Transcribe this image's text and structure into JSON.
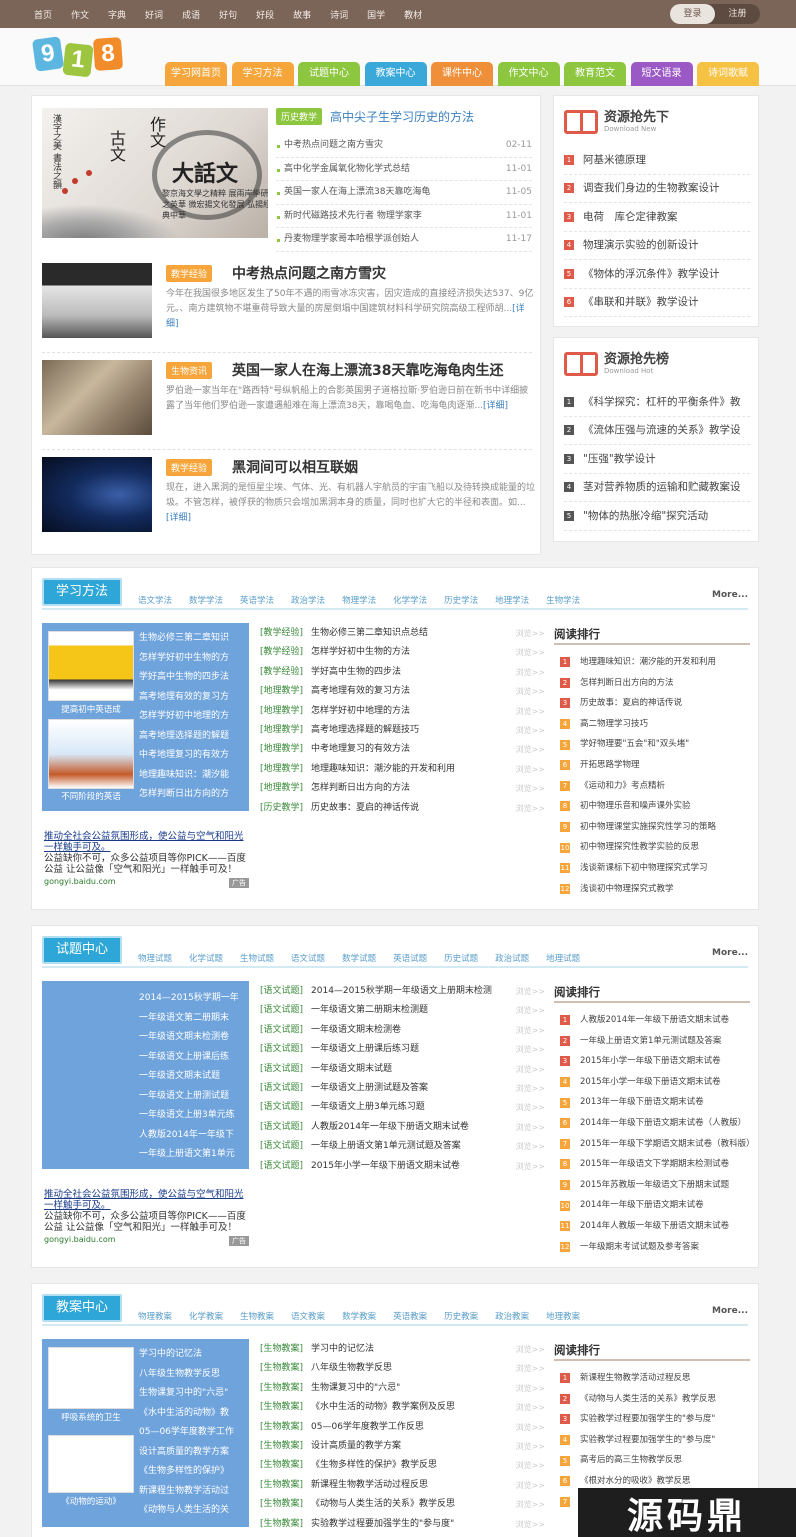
{
  "topnav": [
    "首页",
    "作文",
    "字典",
    "好词",
    "成语",
    "好句",
    "好段",
    "故事",
    "诗词",
    "国学",
    "教材"
  ],
  "auth": {
    "login": "登录",
    "register": "注册"
  },
  "logo": [
    "9",
    "1",
    "8"
  ],
  "mainnav": [
    {
      "label": "学习网首页",
      "color": "#f6a53a"
    },
    {
      "label": "学习方法",
      "color": "#f6a53a"
    },
    {
      "label": "试题中心",
      "color": "#8dc63f"
    },
    {
      "label": "教案中心",
      "color": "#3aa8d8"
    },
    {
      "label": "课件中心",
      "color": "#f08f3a"
    },
    {
      "label": "作文中心",
      "color": "#8dc63f"
    },
    {
      "label": "教育范文",
      "color": "#8dc63f"
    },
    {
      "label": "短文语录",
      "color": "#9b59c6"
    },
    {
      "label": "诗词歌赋",
      "color": "#f6c244"
    }
  ],
  "headline": {
    "image_title": "大話文",
    "image_sub": "黎京海文學之精粹 展兩岸學研之英華 微宏揚文化發展 弘揚經典中華",
    "tag": "历史教学",
    "title": "高中尖子生学习历史的方法",
    "items": [
      {
        "title": "中考热点问题之南方雪灾",
        "date": "02-11"
      },
      {
        "title": "高中化学金属氧化物化学式总结",
        "date": "11-01"
      },
      {
        "title": "英国一家人在海上漂流38天靠吃海龟",
        "date": "11-05"
      },
      {
        "title": "新时代磁路技术先行者 物理学家李",
        "date": "11-01"
      },
      {
        "title": "丹麦物理学家哥本哈根学派创始人",
        "date": "11-17"
      }
    ]
  },
  "articles": [
    {
      "tag": "教学经验",
      "title": "中考热点问题之南方雪灾",
      "desc": "今年在我国很多地区发生了50年不遇的雨雪冰冻灾害，因灾造成的直接经济损失达537、9亿元。、南方建筑物不堪重荷导致大量的房屋倒塌中国建筑材料科学研究院高级工程师胡...",
      "more": "[详细]"
    },
    {
      "tag": "生物资讯",
      "title": "英国一家人在海上漂流38天靠吃海龟肉生还",
      "desc": "罗伯逊一家当年在\"路西特\"号纵帆船上的合影英国男子道格拉斯·罗伯逊日前在新书中详细披露了当年他们罗伯逊一家遭遇船难在海上漂流38天，靠喝龟血、吃海龟肉逐渐...",
      "more": "[详细]"
    },
    {
      "tag": "教学经验",
      "title": "黑洞间可以相互联姻",
      "desc": "现在，进入黑洞的是恒星尘埃、气体、光、有机器人宇航员的宇宙飞船以及待转换成能量的垃圾。不管怎样，被俘获的物质只会增加黑洞本身的质量，同时也扩大它的半径和表面。如...",
      "more": "[详细]"
    }
  ],
  "res_new": {
    "title": "资源抢先下",
    "sub": "Download New",
    "items": [
      "阿基米德原理",
      "调查我们身边的生物教案设计",
      "电荷　库仑定律教案",
      "物理演示实验的创新设计",
      "《物体的浮沉条件》教学设计",
      "《串联和并联》教学设计"
    ]
  },
  "res_hot": {
    "title": "资源抢先榜",
    "sub": "Download Hot",
    "items": [
      "《科学探究：杠杆的平衡条件》教",
      "《流体压强与流速的关系》教学设",
      "\"压强\"教学设计",
      "茎对营养物质的运输和贮藏教案设",
      "\"物体的热胀冷缩\"探究活动"
    ]
  },
  "sections": [
    {
      "tab": "学习方法",
      "subs": [
        "语文学法",
        "数学学法",
        "英语学法",
        "政治学法",
        "物理学法",
        "化学学法",
        "历史学法",
        "地理学法",
        "生物学法"
      ],
      "more": "More...",
      "captions": [
        "提高初中英语成",
        "不同阶段的英语"
      ],
      "links": [
        "生物必修三第二章知识",
        "怎样学好初中生物的方",
        "学好高中生物的四步法",
        "高考地理有效的复习方",
        "怎样学好初中地理的方",
        "高考地理选择题的解题",
        "中考地理复习的有效方",
        "地理趣味知识：潮汐能",
        "怎样判断日出方向的方"
      ],
      "ad": {
        "l1": "推动全社会公益氛围形成，使公益与空气和阳光一样触手可及。",
        "l2": "公益缺你不可，众多公益项目等你PICK——百度公益 让公益像「空气和阳光」一样触手可及！",
        "l3": "gongyi.baidu.com",
        "badge": "广告"
      },
      "mid": [
        {
          "cat": "[教学经验]",
          "title": "生物必修三第二章知识点总结"
        },
        {
          "cat": "[教学经验]",
          "title": "怎样学好初中生物的方法"
        },
        {
          "cat": "[教学经验]",
          "title": "学好高中生物的四步法"
        },
        {
          "cat": "[地理教学]",
          "title": "高考地理有效的复习方法"
        },
        {
          "cat": "[地理教学]",
          "title": "怎样学好初中地理的方法"
        },
        {
          "cat": "[地理教学]",
          "title": "高考地理选择题的解题技巧"
        },
        {
          "cat": "[地理教学]",
          "title": "中考地理复习的有效方法"
        },
        {
          "cat": "[地理教学]",
          "title": "地理趣味知识：潮汐能的开发和利用"
        },
        {
          "cat": "[地理教学]",
          "title": "怎样判断日出方向的方法"
        },
        {
          "cat": "[历史教学]",
          "title": "历史故事：夏启的神话传说"
        }
      ],
      "views": "浏览>>",
      "rank_title": "阅读排行",
      "rank": [
        "地理趣味知识：潮汐能的开发和利用",
        "怎样判断日出方向的方法",
        "历史故事：夏启的神话传说",
        "高二物理学习技巧",
        "学好物理要\"五会\"和\"双头堵\"",
        "开拓思路学物理",
        "《运动和力》考点精析",
        "初中物理乐音和噪声课外实验",
        "初中物理课堂实施探究性学习的策略",
        "初中物理探究性教学实验的反思",
        "浅谈新课标下初中物理探究式学习",
        "浅谈初中物理探究式教学"
      ]
    },
    {
      "tab": "试题中心",
      "subs": [
        "物理试题",
        "化学试题",
        "生物试题",
        "语文试题",
        "数学试题",
        "英语试题",
        "历史试题",
        "政治试题",
        "地理试题"
      ],
      "more": "More...",
      "captions": [],
      "links": [
        "2014—2015秋学期一年",
        "一年级语文第二册期末",
        "一年级语文期末检测卷",
        "一年级语文上册课后练",
        "一年级语文期末试题",
        "一年级语文上册测试题",
        "一年级语文上册3单元练",
        "人教版2014年一年级下",
        "一年级上册语文第1单元"
      ],
      "ad": {
        "l1": "推动全社会公益氛围形成，使公益与空气和阳光一样触手可及。",
        "l2": "公益缺你不可，众多公益项目等你PICK——百度公益 让公益像「空气和阳光」一样触手可及！",
        "l3": "gongyi.baidu.com",
        "badge": "广告"
      },
      "mid": [
        {
          "cat": "[语文试题]",
          "title": "2014—2015秋学期一年级语文上册期末检测"
        },
        {
          "cat": "[语文试题]",
          "title": "一年级语文第二册期末检测题"
        },
        {
          "cat": "[语文试题]",
          "title": "一年级语文期末检测卷"
        },
        {
          "cat": "[语文试题]",
          "title": "一年级语文上册课后练习题"
        },
        {
          "cat": "[语文试题]",
          "title": "一年级语文期末试题"
        },
        {
          "cat": "[语文试题]",
          "title": "一年级语文上册测试题及答案"
        },
        {
          "cat": "[语文试题]",
          "title": "一年级语文上册3单元练习题"
        },
        {
          "cat": "[语文试题]",
          "title": "人教版2014年一年级下册语文期末试卷"
        },
        {
          "cat": "[语文试题]",
          "title": "一年级上册语文第1单元测试题及答案"
        },
        {
          "cat": "[语文试题]",
          "title": "2015年小学一年级下册语文期末试卷"
        }
      ],
      "views": "浏览>>",
      "rank_title": "阅读排行",
      "rank": [
        "人教版2014年一年级下册语文期末试卷",
        "一年级上册语文第1单元测试题及答案",
        "2015年小学一年级下册语文期末试卷",
        "2015年小学一年级下册语文期末试卷",
        "2013年一年级下册语文期末试卷",
        "2014年一年级下册语文期末试卷（人教版）",
        "2015年一年级下学期语文期末试卷（教科版）",
        "2015年一年级语文下学期期末检测试卷",
        "2015年苏教版一年级语文下册期末试题",
        "2014年一年级下册语文期末试卷",
        "2014年人教版一年级下册语文期末试卷",
        "一年级期末考试试题及参考答案"
      ]
    },
    {
      "tab": "教案中心",
      "subs": [
        "物理教案",
        "化学教案",
        "生物教案",
        "语文教案",
        "数学教案",
        "英语教案",
        "历史教案",
        "政治教案",
        "地理教案"
      ],
      "more": "More...",
      "captions": [
        "呼吸系统的卫生",
        "《动物的运动》"
      ],
      "links": [
        "学习中的记忆法",
        "八年级生物教学反思",
        "生物课复习中的\"六忌\"",
        "《水中生活的动物》教",
        "05—06学年度教学工作",
        "设计高质量的教学方案",
        "《生物多样性的保护》",
        "新课程生物教学活动过",
        "《动物与人类生活的关"
      ],
      "mid": [
        {
          "cat": "[生物教案]",
          "title": "学习中的记忆法"
        },
        {
          "cat": "[生物教案]",
          "title": "八年级生物教学反思"
        },
        {
          "cat": "[生物教案]",
          "title": "生物课复习中的\"六忌\""
        },
        {
          "cat": "[生物教案]",
          "title": "《水中生活的动物》教学案例及反思"
        },
        {
          "cat": "[生物教案]",
          "title": "05—06学年度教学工作反思"
        },
        {
          "cat": "[生物教案]",
          "title": "设计高质量的教学方案"
        },
        {
          "cat": "[生物教案]",
          "title": "《生物多样性的保护》教学反思"
        },
        {
          "cat": "[生物教案]",
          "title": "新课程生物教学活动过程反思"
        },
        {
          "cat": "[生物教案]",
          "title": "《动物与人类生活的关系》教学反思"
        },
        {
          "cat": "[生物教案]",
          "title": "实验教学过程要加强学生的\"参与度\""
        }
      ],
      "views": "浏览>>",
      "rank_title": "阅读排行",
      "rank": [
        "新课程生物教学活动过程反思",
        "《动物与人类生活的关系》教学反思",
        "实验教学过程要加强学生的\"参与度\"",
        "实验教学过程要加强学生的\"参与度\"",
        "高考后的高三生物教学反思",
        "《根对水分的吸收》教学反思",
        "动物在自然界中的作用教学设计"
      ]
    }
  ],
  "watermark": "源码鼎"
}
